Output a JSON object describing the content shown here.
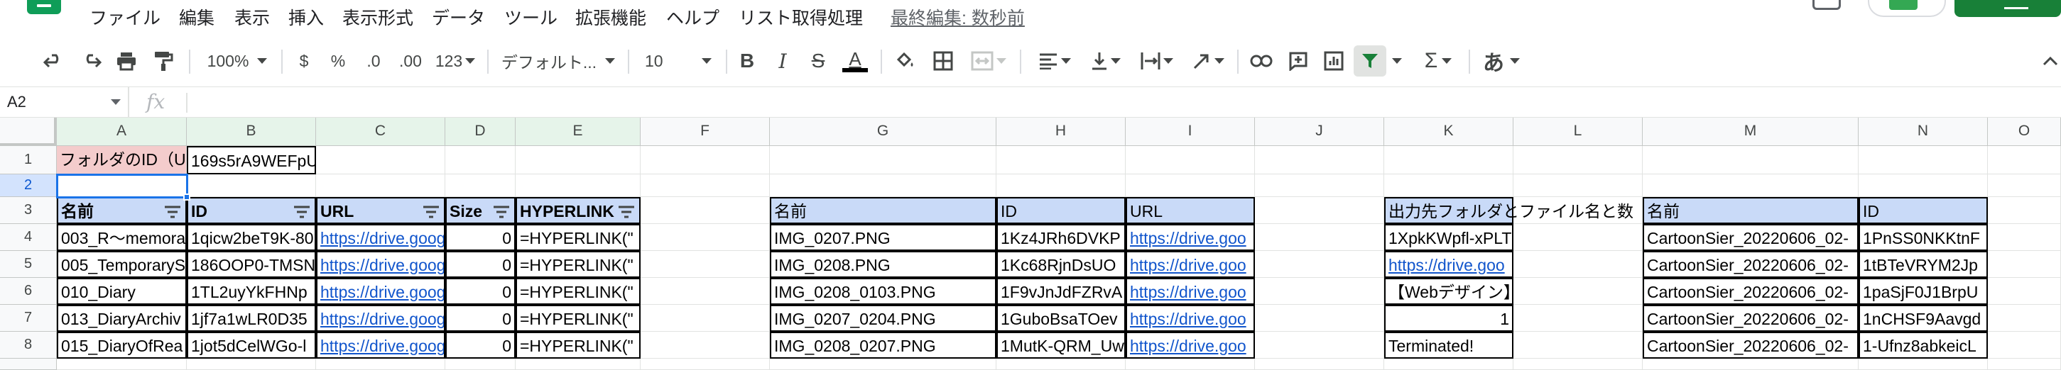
{
  "menu": {
    "items": [
      "ファイル",
      "編集",
      "表示",
      "挿入",
      "表示形式",
      "データ",
      "ツール",
      "拡張機能",
      "ヘルプ",
      "リスト取得処理"
    ],
    "last_edit": "最終編集: 数秒前"
  },
  "toolbar": {
    "zoom": "100%",
    "currency": "$",
    "percent": "%",
    "decimal_decrease": ".0",
    "decimal_increase": ".00",
    "number_format": "123",
    "font_family": "デフォルト...",
    "font_size": "10",
    "bold": "B",
    "italic": "I",
    "strike": "S",
    "text_color": "A",
    "input_tools": "あ",
    "text_color_hex": "#000000",
    "filter_active_hex": "#188038"
  },
  "formula_bar": {
    "name_box": "A2",
    "fx": "fx",
    "content": ""
  },
  "grid": {
    "columns": [
      "A",
      "B",
      "C",
      "D",
      "E",
      "F",
      "G",
      "H",
      "I",
      "J",
      "K",
      "L",
      "M",
      "N",
      "O"
    ],
    "rows": [
      "1",
      "2",
      "3",
      "4",
      "5",
      "6",
      "7",
      "8"
    ],
    "selected_cell": "A2",
    "cells": {
      "r1": {
        "A": "フォルダのID（U",
        "B": "169s5rA9WEFpU"
      },
      "r3": {
        "A": "名前",
        "B": "ID",
        "C": "URL",
        "D": "Size",
        "E": "HYPERLINK",
        "G": "名前",
        "H": "ID",
        "I": "URL",
        "K": "出力先フォルダとファイル名と数",
        "M": "名前",
        "N": "ID"
      },
      "r4": {
        "A": "003_R～memora",
        "B": "1qicw2beT9K-80",
        "C": "https://drive.goog",
        "D": "0",
        "E": "=HYPERLINK(\"",
        "G": "IMG_0207.PNG",
        "H": "1Kz4JRh6DVKP",
        "I": "https://drive.goo",
        "K": "1XpkKWpfl-xPLT",
        "M": "CartoonSier_20220606_02-",
        "N": "1PnSS0NKKtnF"
      },
      "r5": {
        "A": "005_TemporaryS",
        "B": "186OOP0-TMSN",
        "C": "https://drive.goog",
        "D": "0",
        "E": "=HYPERLINK(\"",
        "G": "IMG_0208.PNG",
        "H": "1Kc68RjnDsUO",
        "I": "https://drive.goo",
        "K": "https://drive.goo",
        "M": "CartoonSier_20220606_02-",
        "N": "1tBTeVRYM2Jp"
      },
      "r6": {
        "A": "010_Diary",
        "B": "1TL2uyYkFHNp",
        "C": "https://drive.goog",
        "D": "0",
        "E": "=HYPERLINK(\"",
        "G": "IMG_0208_0103.PNG",
        "H": "1F9vJnJdFZRvA",
        "I": "https://drive.goo",
        "K": "【Webデザイン】",
        "M": "CartoonSier_20220606_02-",
        "N": "1paSjF0J1BrpU"
      },
      "r7": {
        "A": "013_DiaryArchiv",
        "B": "1jf7a1wLR0D35",
        "C": "https://drive.goog",
        "D": "0",
        "E": "=HYPERLINK(\"",
        "G": "IMG_0207_0204.PNG",
        "H": "1GuboBsaTOev",
        "I": "https://drive.goo",
        "K": "1",
        "M": "CartoonSier_20220606_02-",
        "N": "1nCHSF9Aavgd"
      },
      "r8": {
        "A": "015_DiaryOfRea",
        "B": "1jot5dCelWGo-l",
        "C": "https://drive.goog",
        "D": "0",
        "E": "=HYPERLINK(\"",
        "G": "IMG_0208_0207.PNG",
        "H": "1MutK-QRM_Uw",
        "I": "https://drive.goo",
        "K": "Terminated!",
        "M": "CartoonSier_20220606_02-",
        "N": "1-Ufnz8abkeicL"
      }
    }
  }
}
